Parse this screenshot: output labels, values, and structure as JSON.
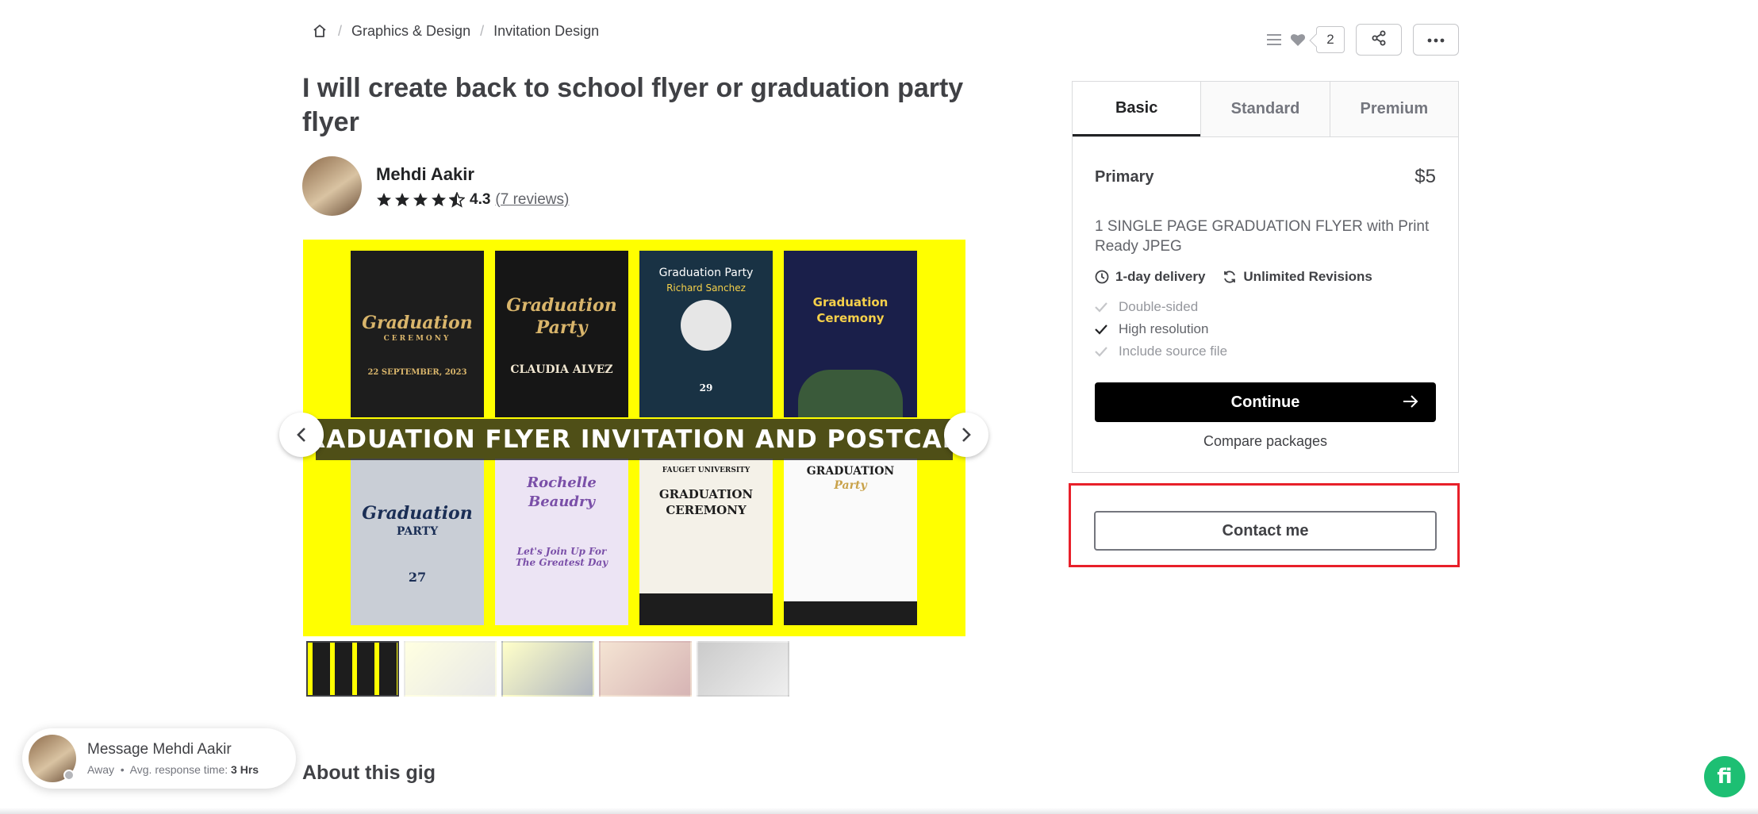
{
  "breadcrumb": {
    "home_icon": "home-icon",
    "items": [
      "Graphics & Design",
      "Invitation Design"
    ],
    "separator": "/"
  },
  "top_actions": {
    "collections_icon": "menu-icon",
    "favorite_icon": "heart-icon",
    "favorite_count": "2",
    "share_icon": "share-icon",
    "more_icon": "more-icon"
  },
  "gig": {
    "title": "I will create back to school flyer or graduation party flyer",
    "seller_name": "Mehdi Aakir",
    "rating": "4.3",
    "rating_stars": 4.5,
    "reviews_label": "(7 reviews)"
  },
  "gallery": {
    "banner_text": "RADUATION FLYER INVITATION AND POSTCAR",
    "prev_icon": "chevron-left-icon",
    "next_icon": "chevron-right-icon",
    "posters": [
      {
        "lines": [
          "Graduation",
          "CEREMONY",
          "22 SEPTEMBER, 2023"
        ]
      },
      {
        "lines": [
          "Graduation",
          "Party",
          "CLAUDIA ALVEZ"
        ]
      },
      {
        "lines": [
          "Graduation Party",
          "Richard Sanchez",
          "29"
        ]
      },
      {
        "lines": [
          "Graduation",
          "Ceremony"
        ]
      },
      {
        "lines": [
          "Graduation",
          "PARTY",
          "27"
        ]
      },
      {
        "lines": [
          "Rochelle",
          "Beaudry",
          "Let's Join Up For The Greatest Day"
        ]
      },
      {
        "lines": [
          "FAUGET UNIVERSITY",
          "GRADUATION",
          "CEREMONY"
        ]
      },
      {
        "lines": [
          "GRADUATION",
          "Party"
        ]
      }
    ],
    "thumbnail_count": 5
  },
  "about": {
    "heading": "About this gig"
  },
  "package": {
    "tabs": [
      "Basic",
      "Standard",
      "Premium"
    ],
    "active_tab": "Basic",
    "name": "Primary",
    "price": "$5",
    "description": "1 SINGLE PAGE GRADUATION FLYER with Print Ready JPEG",
    "delivery": "1-day delivery",
    "revisions": "Unlimited Revisions",
    "features": [
      {
        "label": "Double-sided",
        "included": false
      },
      {
        "label": "High resolution",
        "included": true
      },
      {
        "label": "Include source file",
        "included": false
      }
    ],
    "continue_label": "Continue",
    "compare_label": "Compare packages"
  },
  "contact": {
    "label": "Contact me"
  },
  "message_widget": {
    "title": "Message Mehdi Aakir",
    "status": "Away",
    "response_label": "Avg. response time:",
    "response_value": "3 Hrs"
  },
  "fab": {
    "label": "fi"
  },
  "colors": {
    "accent_red": "#e8202a",
    "brand_green": "#1dbf73",
    "gallery_bg": "#ffff00"
  }
}
